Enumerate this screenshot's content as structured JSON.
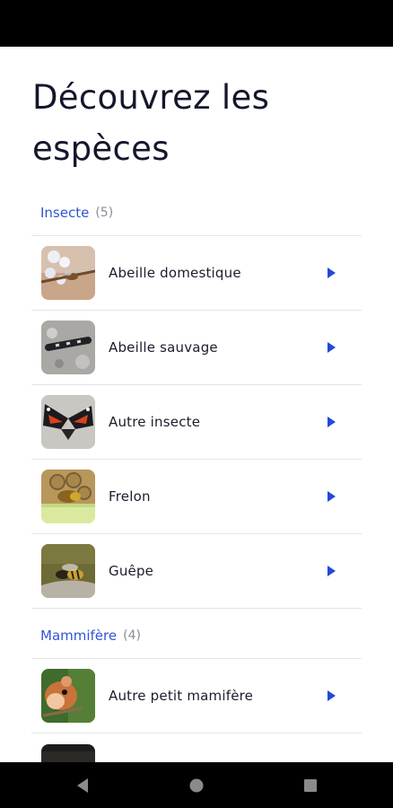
{
  "page": {
    "title": "Découvrez les espèces"
  },
  "sections": [
    {
      "title": "Insecte",
      "count": "(5)",
      "items": [
        {
          "label": "Abeille domestique"
        },
        {
          "label": "Abeille sauvage"
        },
        {
          "label": "Autre insecte"
        },
        {
          "label": "Frelon"
        },
        {
          "label": "Guêpe"
        }
      ]
    },
    {
      "title": "Mammifère",
      "count": "(4)",
      "items": [
        {
          "label": "Autre petit mamifère"
        }
      ]
    }
  ],
  "icons": {
    "row_chevron": "play-triangle-icon",
    "nav_back": "back-triangle-icon",
    "nav_home": "home-circle-icon",
    "nav_recents": "recents-square-icon"
  },
  "colors": {
    "accent": "#2f55d4",
    "text": "#14172b",
    "muted": "#8a8d96",
    "divider": "#e4e5e8"
  }
}
